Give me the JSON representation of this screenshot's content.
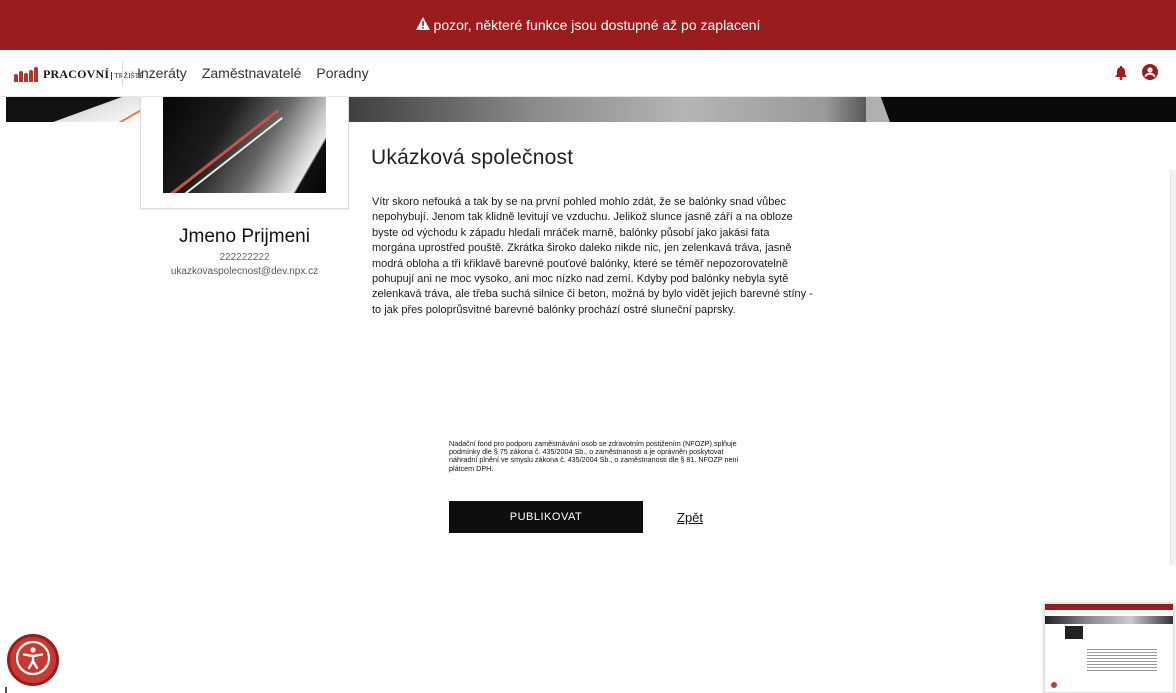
{
  "alert": {
    "icon": "warning-icon",
    "text": "pozor, některé funkce jsou dostupné až po zaplacení",
    "background": "#9b1c1c"
  },
  "header": {
    "logo": {
      "text": "PRACOVNÍ",
      "sub": "TRŽIŠTĚ"
    },
    "nav": [
      "Inzeráty",
      "Zaměstnavatelé",
      "Poradny"
    ],
    "icons": [
      "bell-icon",
      "user-circle-icon"
    ],
    "accent": "#9b1c1c"
  },
  "profile": {
    "name": "Jmeno Prijmeni",
    "phone": "222222222",
    "email": "ukazkovaspolecnost@dev.npx.cz"
  },
  "company": {
    "title": "Ukázková společnost",
    "description": "Vítr skoro nefouká a tak by se na první pohled mohlo zdát, že se balónky snad vůbec nepohybují. Jenom tak klidně levitují ve vzduchu. Jelikož slunce jasně září a na obloze byste od východu k západu hledali mráček marně, balónky působí jako jakási fata morgána uprostřed pouště. Zkrátka široko daleko nikde nic, jen zelenkavá tráva, jasně modrá obloha a tři křiklavě barevné pouťové balónky, které se téměř nepozorovatelně pohupují ani ne moc vysoko, ani moc nízko nad zemí. Kdyby pod balónky nebyla sytě zelenkavá tráva, ale třeba suchá silnice či beton, možná by bylo vidět jejich barevné stíny - to jak přes poloprůsvitné barevné balónky prochází ostré sluneční paprsky."
  },
  "legal": {
    "text": "Nadační fond pro podporu zaměstnávání osob se zdravotním postižením (NFOZP) splňuje podmínky dle § 75 zákona č. 435/2004 Sb., o zaměstnanosti a je oprávněn poskytovat náhradní plnění ve smyslu zákona č. 435/2004 Sb., o zaměstnanosti dle § 81. NFOZP není plátcem DPH."
  },
  "actions": {
    "publish_label": "PUBLIKOVAT",
    "back_label": "Zpět"
  },
  "accessibility": {
    "icon": "accessibility-icon",
    "color": "#c53a32"
  }
}
